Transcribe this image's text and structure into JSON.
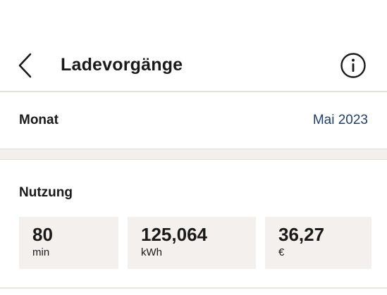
{
  "header": {
    "title": "Ladevorgänge",
    "back_icon": "chevron-left-icon",
    "info_icon": "info-circle-icon"
  },
  "month": {
    "label": "Monat",
    "value": "Mai 2023",
    "value_color": "#1f3f6e"
  },
  "usage": {
    "heading": "Nutzung",
    "cards": [
      {
        "value": "80",
        "unit": "min"
      },
      {
        "value": "125,064",
        "unit": "kWh"
      },
      {
        "value": "36,27",
        "unit": "€"
      }
    ]
  }
}
